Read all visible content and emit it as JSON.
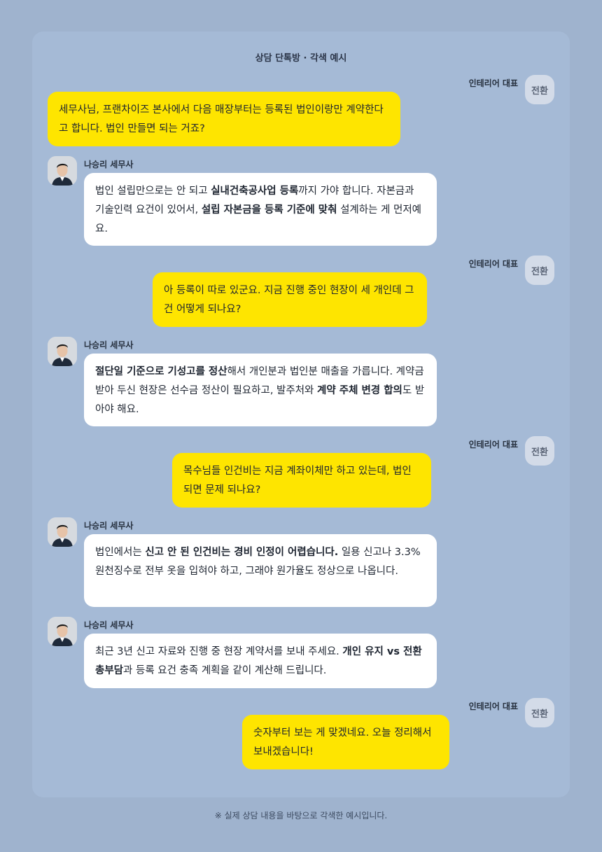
{
  "header": {
    "title": "상담 단톡방 · 각색 예시"
  },
  "footer": {
    "note": "※ 실제 상담 내용을 바탕으로 각색한 예시입니다."
  },
  "participants": {
    "client_name": "인테리어 대표",
    "client_badge": "전환",
    "advisor_name": "나승리 세무사"
  },
  "messages": [
    {
      "from": "client",
      "segments": [
        "세무사님, 프랜차이즈 본사에서 다음 매장부터는 등록된 법인이랑만 계약한다고 합니다. 법인 만들면 되는 거죠?"
      ]
    },
    {
      "from": "advisor",
      "segments": [
        "법인 설립만으로는 안 되고 ",
        "실내건축공사업 등록",
        "까지 가야 합니다. 자본금과 기술인력 요건이 있어서, ",
        "설립 자본금을 등록 기준에 맞춰",
        " 설계하는 게 먼저예요."
      ]
    },
    {
      "from": "client",
      "segments": [
        "아 등록이 따로 있군요. 지금 진행 중인 현장이 세 개인데 그건 어떻게 되나요?"
      ]
    },
    {
      "from": "advisor",
      "segments": [
        "절단일 기준으로 기성고를 정산",
        "해서 개인분과 법인분 매출을 가릅니다. 계약금 받아 두신 현장은 선수금 정산이 필요하고, 발주처와 ",
        "계약 주체 변경 합의",
        "도 받아야 해요."
      ]
    },
    {
      "from": "client",
      "segments": [
        "목수님들 인건비는 지금 계좌이체만 하고 있는데, 법인 되면 문제 되나요?"
      ]
    },
    {
      "from": "advisor",
      "segments": [
        "법인에서는 ",
        "신고 안 된 인건비는 경비 인정이 어렵습니다.",
        " 일용 신고나 3.3% 원천징수로 전부 옷을 입혀야 하고, 그래야 원가율도 정상으로 나옵니다."
      ]
    },
    {
      "from": "advisor",
      "segments": [
        "최근 3년 신고 자료와 진행 중 현장 계약서를 보내 주세요. ",
        "개인 유지 vs 전환 총부담",
        "과 등록 요건 충족 계획을 같이 계산해 드립니다."
      ]
    },
    {
      "from": "client",
      "segments": [
        "숫자부터 보는 게 맞겠네요. 오늘 정리해서 보내겠습니다!"
      ]
    }
  ]
}
